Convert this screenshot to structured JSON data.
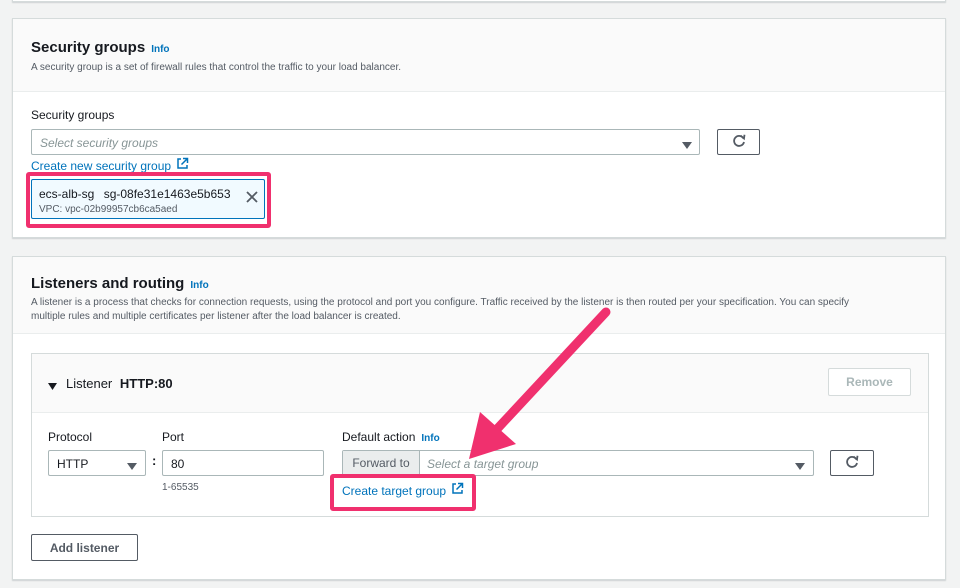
{
  "security_groups": {
    "title": "Security groups",
    "info": "Info",
    "description": "A security group is a set of firewall rules that control the traffic to your load balancer.",
    "field_label": "Security groups",
    "placeholder": "Select security groups",
    "create_link": "Create new security group",
    "selected": {
      "name": "ecs-alb-sg",
      "id": "sg-08fe31e1463e5b653",
      "vpc": "VPC: vpc-02b99957cb6ca5aed"
    }
  },
  "listeners": {
    "title": "Listeners and routing",
    "info": "Info",
    "description_line1": "A listener is a process that checks for connection requests, using the protocol and port you configure. Traffic received by the listener is then routed per your specification. You can specify",
    "description_line2": "multiple rules and multiple certificates per listener after the load balancer is created.",
    "listener": {
      "label": "Listener",
      "name": "HTTP:80",
      "remove_label": "Remove",
      "protocol_label": "Protocol",
      "protocol_value": "HTTP",
      "colon": ":",
      "port_label": "Port",
      "port_value": "80",
      "port_hint": "1-65535",
      "default_action_label": "Default action",
      "default_action_info": "Info",
      "forward_to": "Forward to",
      "target_placeholder": "Select a target group",
      "create_target_link": "Create target group"
    },
    "add_listener_label": "Add listener"
  },
  "icons": {
    "dropdown": "caret-down-icon",
    "refresh": "refresh-icon",
    "external": "external-link-icon",
    "remove": "close-icon",
    "expand": "caret-expanded-icon"
  },
  "colors": {
    "highlight": "#f0306e",
    "link": "#0073bb"
  }
}
